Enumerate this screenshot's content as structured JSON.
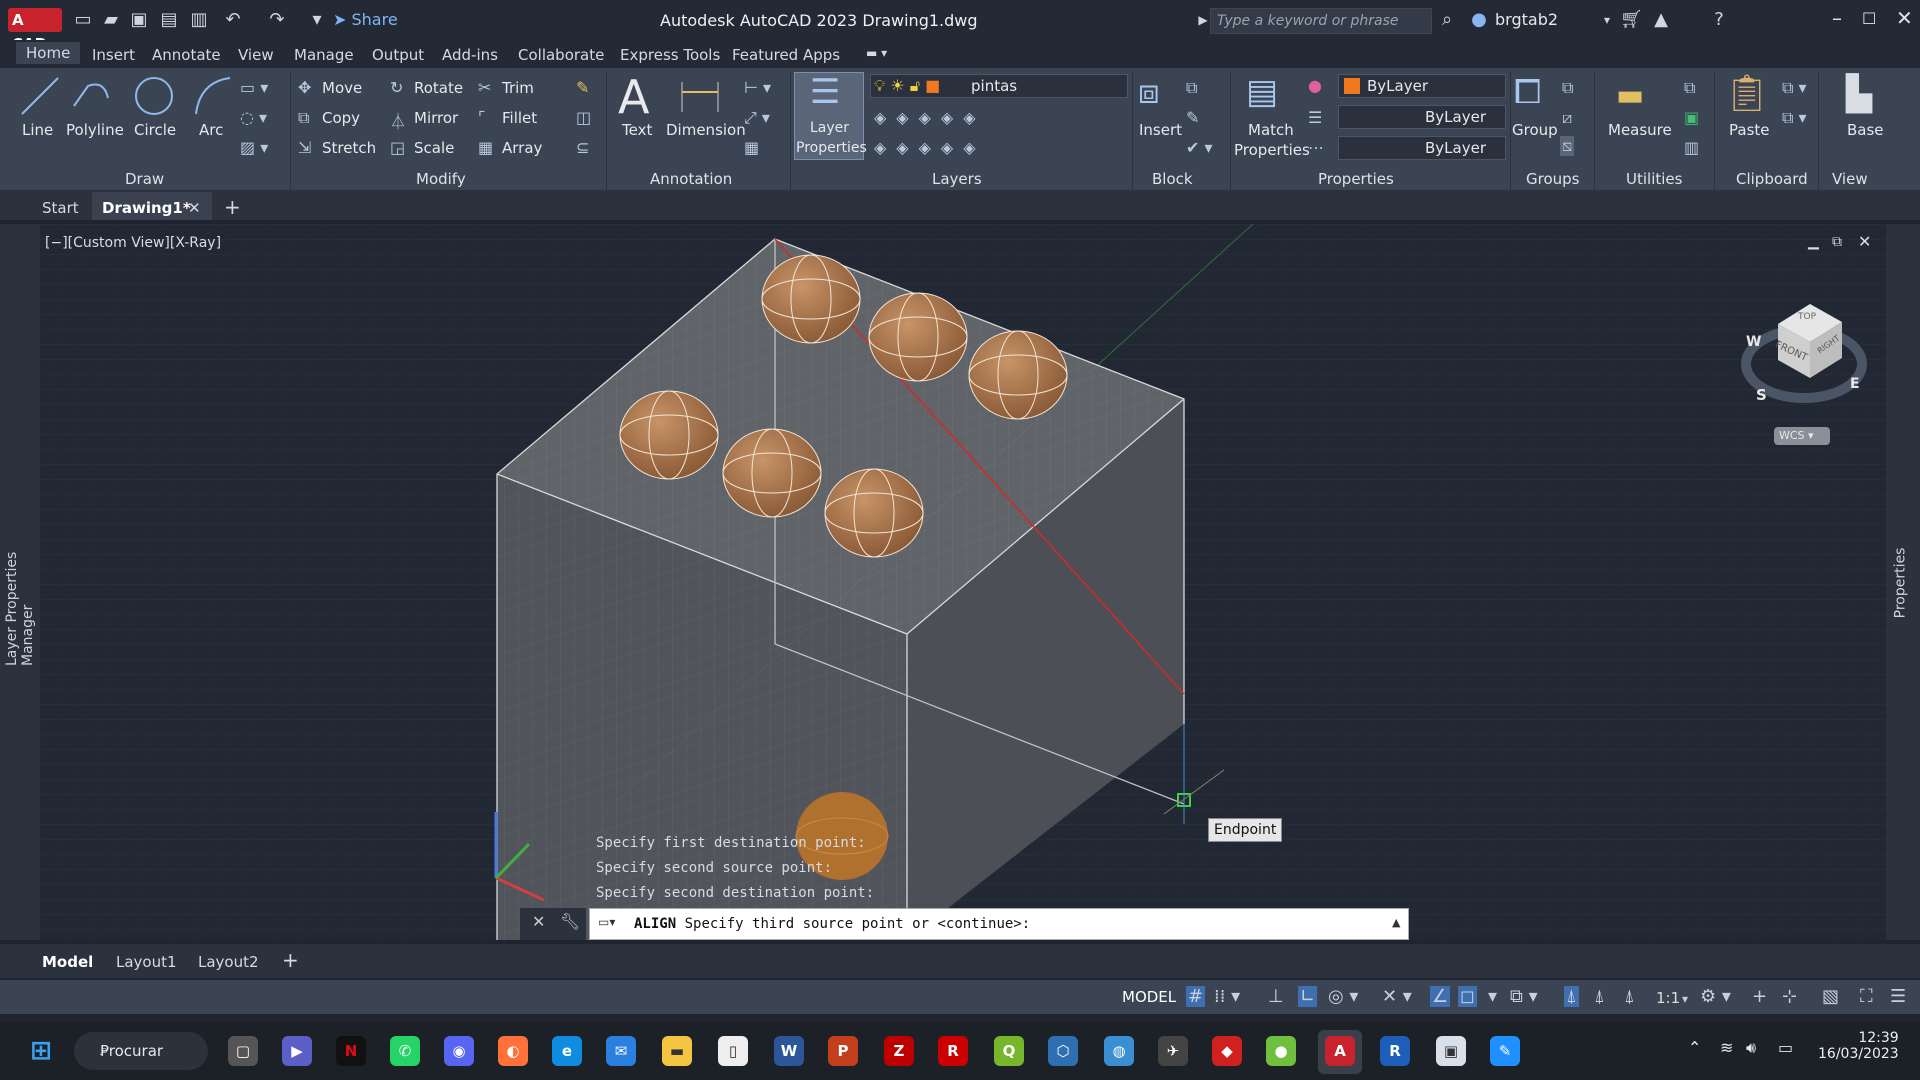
{
  "titlebar": {
    "app_badge": "A CAD",
    "share": "Share",
    "title": "Autodesk AutoCAD 2023    Drawing1.dwg",
    "search_placeholder": "Type a keyword or phrase",
    "username": "brgtab2"
  },
  "menu": {
    "tabs": [
      "Home",
      "Insert",
      "Annotate",
      "View",
      "Manage",
      "Output",
      "Add-ins",
      "Collaborate",
      "Express Tools",
      "Featured Apps"
    ]
  },
  "ribbon": {
    "draw": {
      "title": "Draw",
      "line": "Line",
      "polyline": "Polyline",
      "circle": "Circle",
      "arc": "Arc"
    },
    "modify": {
      "title": "Modify",
      "move": "Move",
      "rotate": "Rotate",
      "trim": "Trim",
      "copy": "Copy",
      "mirror": "Mirror",
      "fillet": "Fillet",
      "stretch": "Stretch",
      "scale": "Scale",
      "array": "Array"
    },
    "annotation": {
      "title": "Annotation",
      "text": "Text",
      "dimension": "Dimension"
    },
    "layers": {
      "title": "Layers",
      "layer_properties_1": "Layer",
      "layer_properties_2": "Properties",
      "current_layer": "pintas"
    },
    "block": {
      "title": "Block",
      "insert": "Insert"
    },
    "properties": {
      "title": "Properties",
      "match_1": "Match",
      "match_2": "Properties",
      "color": "ByLayer",
      "linetype": "ByLayer",
      "lineweight": "ByLayer"
    },
    "groups": {
      "title": "Groups",
      "group": "Group"
    },
    "utilities": {
      "title": "Utilities",
      "measure": "Measure"
    },
    "clipboard": {
      "title": "Clipboard",
      "paste": "Paste"
    },
    "view": {
      "title": "View",
      "base": "Base"
    }
  },
  "filetabs": {
    "start": "Start",
    "drawing": "Drawing1*"
  },
  "viewport": {
    "label": "[−][Custom View][X-Ray]",
    "tooltip": "Endpoint",
    "viewcube_top": "TOP",
    "viewcube_front": "FRONT",
    "viewcube_right": "RIGHT",
    "compass_w": "W",
    "compass_s": "S",
    "compass_e": "E",
    "wcs": "WCS"
  },
  "sidepanels": {
    "left": "Layer Properties Manager",
    "right": "Properties"
  },
  "command": {
    "history": [
      "Specify first destination point:",
      "Specify second source point:",
      "Specify second destination point:"
    ],
    "prompt_cmd": "ALIGN",
    "prompt_text": "Specify third source point or <continue>:"
  },
  "layouts": {
    "model": "Model",
    "layout1": "Layout1",
    "layout2": "Layout2"
  },
  "status": {
    "space": "MODEL",
    "scale": "1:1"
  },
  "taskbar": {
    "search": "Procurar",
    "time": "12:39",
    "date": "16/03/2023"
  }
}
